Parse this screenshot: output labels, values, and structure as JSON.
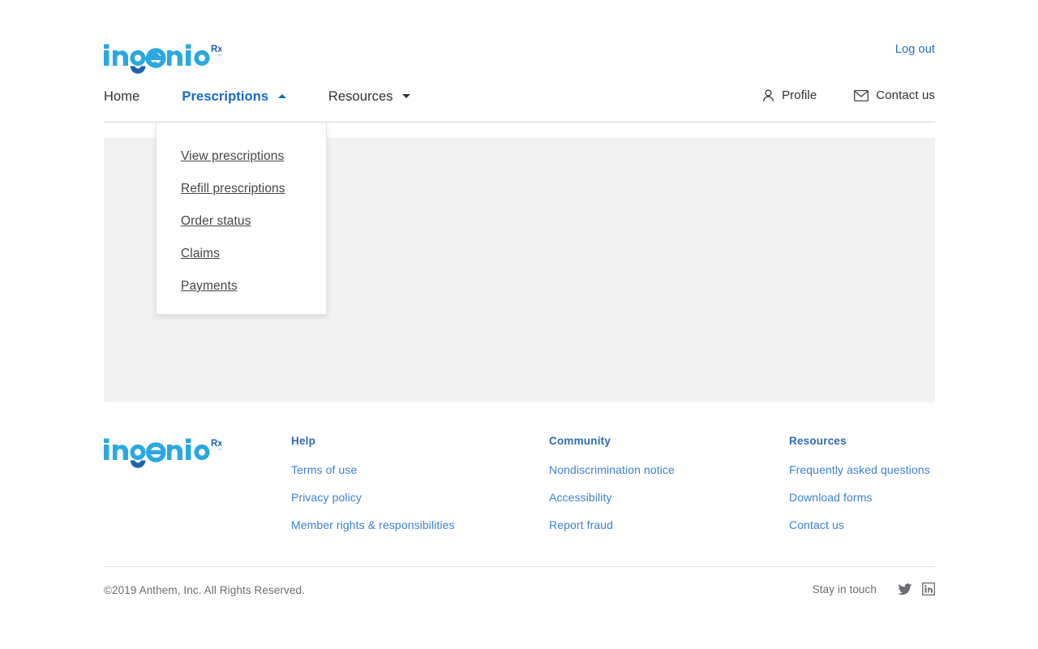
{
  "brand": {
    "logo_text": "ingenio",
    "logo_superscript": "Rx",
    "colors": {
      "logo_light": "#2aa8e0",
      "logo_dark": "#1b63ad",
      "link_blue": "#3a82d4",
      "nav_active": "#1769cb",
      "heading_blue": "#2f6cb5",
      "text_dark": "#2f3034",
      "content_grey": "#f2f2f2"
    }
  },
  "topbar": {
    "logout_label": "Log out"
  },
  "nav": {
    "items": [
      {
        "label": "Home",
        "active": false,
        "has_caret": false
      },
      {
        "label": "Prescriptions",
        "active": true,
        "has_caret": true,
        "caret": "up"
      },
      {
        "label": "Resources",
        "active": false,
        "has_caret": true,
        "caret": "down"
      }
    ],
    "right_items": [
      {
        "label": "Profile",
        "icon": "user-icon"
      },
      {
        "label": "Contact us",
        "icon": "envelope-icon"
      }
    ]
  },
  "dropdown": {
    "open_for": "Prescriptions",
    "items": [
      {
        "label": "View prescriptions"
      },
      {
        "label": "Refill prescriptions"
      },
      {
        "label": "Order status"
      },
      {
        "label": "Claims"
      },
      {
        "label": "Payments"
      }
    ]
  },
  "footer": {
    "columns": [
      {
        "heading": "Help",
        "links": [
          "Terms of use",
          "Privacy policy",
          "Member rights & responsibilities"
        ]
      },
      {
        "heading": "Community",
        "links": [
          "Nondiscrimination notice",
          "Accessibility",
          "Report fraud"
        ]
      },
      {
        "heading": "Resources",
        "links": [
          "Frequently asked questions",
          "Download forms",
          "Contact us"
        ]
      }
    ]
  },
  "bottombar": {
    "copyright": "©2019 Anthem, Inc. All Rights Reserved.",
    "social_label": "Stay in touch",
    "social_icons": [
      "twitter-icon",
      "linkedin-icon"
    ]
  }
}
